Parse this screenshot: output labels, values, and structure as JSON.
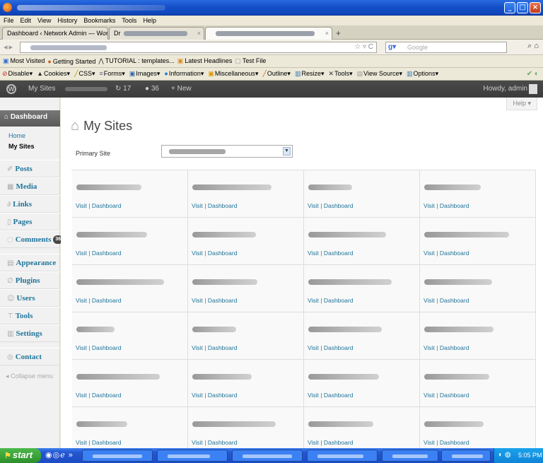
{
  "menu": [
    "File",
    "Edit",
    "View",
    "History",
    "Bookmarks",
    "Tools",
    "Help"
  ],
  "tabs": {
    "first_label": "Dashboard ‹ Network Admin — WordPress",
    "second_label": "Dr",
    "new_tab": "+"
  },
  "search": {
    "placeholder": "Google"
  },
  "bookmarks": [
    "Most Visited",
    "Getting Started",
    "TUTORIAL : templates...",
    "Latest Headlines",
    "Test File"
  ],
  "devtools": [
    "Disable",
    "Cookies",
    "CSS",
    "Forms",
    "Images",
    "Information",
    "Miscellaneous",
    "Outline",
    "Resize",
    "Tools",
    "View Source",
    "Options"
  ],
  "admin_bar": {
    "my_sites": "My Sites",
    "updates": "17",
    "comments": "36",
    "new": "New",
    "howdy": "Howdy, admin"
  },
  "sidebar": {
    "dashboard": "Dashboard",
    "sub": [
      "Home",
      "My Sites"
    ],
    "items": [
      {
        "label": "Posts",
        "icon": "pushpin-icon"
      },
      {
        "label": "Media",
        "icon": "media-icon"
      },
      {
        "label": "Links",
        "icon": "links-icon"
      },
      {
        "label": "Pages",
        "icon": "pages-icon"
      },
      {
        "label": "Comments",
        "icon": "comments-icon",
        "badge": "36"
      },
      {
        "label": "Appearance",
        "icon": "appearance-icon"
      },
      {
        "label": "Plugins",
        "icon": "plugins-icon"
      },
      {
        "label": "Users",
        "icon": "users-icon"
      },
      {
        "label": "Tools",
        "icon": "tools-icon"
      },
      {
        "label": "Settings",
        "icon": "settings-icon"
      },
      {
        "label": "Contact",
        "icon": "contact-icon"
      }
    ],
    "collapse": "Collapse menu"
  },
  "main": {
    "help": "Help ▾",
    "title": "My Sites",
    "primary_site_label": "Primary Site",
    "site_actions": {
      "visit": "Visit",
      "separator": " | ",
      "dashboard": "Dashboard"
    }
  },
  "taskbar": {
    "start": "start",
    "clock": "5:05 PM"
  }
}
